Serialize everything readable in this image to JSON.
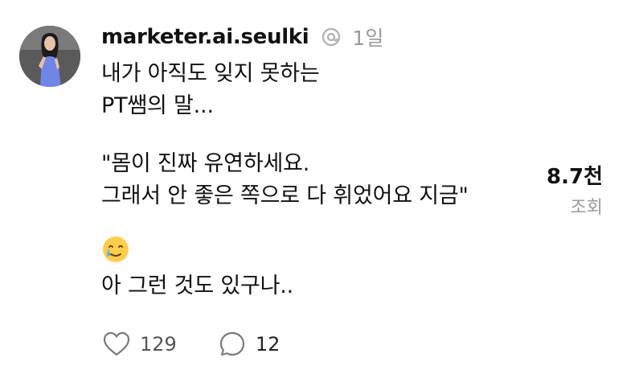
{
  "post": {
    "username": "marketer.ai.seulki",
    "timestamp": "1일",
    "body_lines_1": "내가 아직도 잊지 못하는\nPT쌤의 말...",
    "body_lines_2": "\"몸이 진짜 유연하세요.\n그래서 안 좋은 쪽으로 다 휘었어요 지금\"",
    "emoji": "🥲",
    "body_line_3": "아 그런 것도 있구나.."
  },
  "stats": {
    "views_count": "8.7천",
    "views_label": "조회"
  },
  "actions": {
    "likes": "129",
    "comments": "12"
  },
  "icons": {
    "threads": "threads-logo-icon",
    "like": "heart-icon",
    "comment": "comment-bubble-icon",
    "emoji": "smiling-face-with-tear-emoji"
  },
  "colors": {
    "text": "#111111",
    "muted": "#9a9a9a",
    "avatar_dress": "#6f86e6"
  }
}
